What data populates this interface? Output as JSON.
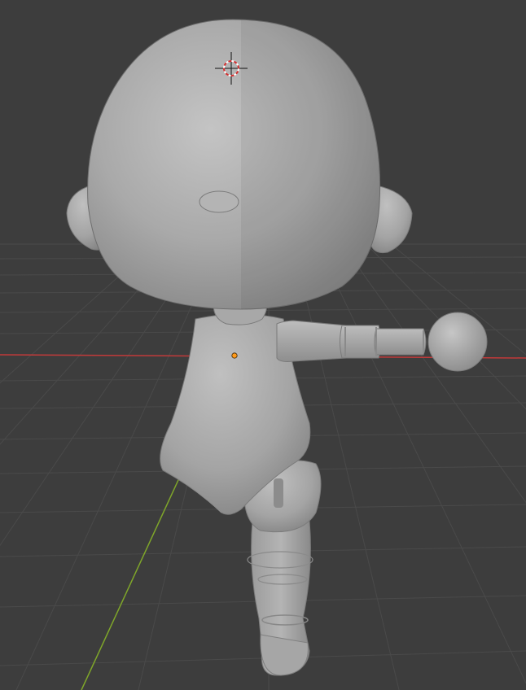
{
  "viewport": {
    "editor": "3D Viewport",
    "shading_mode": "solid",
    "background_color": "#3d3d3d",
    "grid_color": "#4a4a4a",
    "x_axis_color": "#c23a3a",
    "y_axis_color": "#7fa62a"
  },
  "scene": {
    "model_name": "chibi-doll-model",
    "model_color": "#a8a8a8",
    "origin_point_color": "#ff9a1a",
    "cursor_icon": "3d-cursor-icon"
  }
}
